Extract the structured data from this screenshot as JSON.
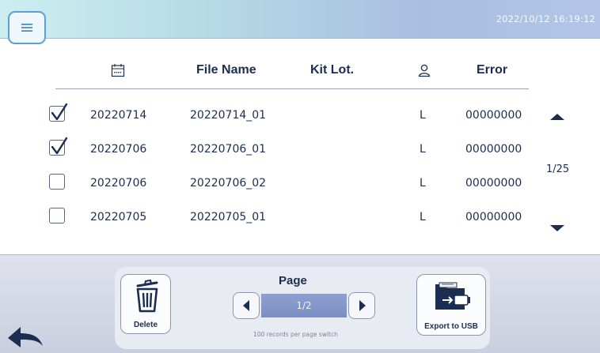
{
  "header": {
    "datetime": "2022/10/12  16:19:12",
    "menu_icon": "hamburger-icon"
  },
  "table": {
    "columns": [
      {
        "icon": "calendar-icon",
        "label": ""
      },
      {
        "label": "File Name"
      },
      {
        "label": "Kit Lot."
      },
      {
        "icon": "user-icon",
        "label": ""
      },
      {
        "label": "Error"
      }
    ],
    "rows": [
      {
        "checked": true,
        "date": "20220714",
        "file_name": "20220714_01",
        "kit_lot": "",
        "user": "L",
        "error": "00000000"
      },
      {
        "checked": true,
        "date": "20220706",
        "file_name": "20220706_01",
        "kit_lot": "",
        "user": "L",
        "error": "00000000"
      },
      {
        "checked": false,
        "date": "20220706",
        "file_name": "20220706_02",
        "kit_lot": "",
        "user": "L",
        "error": "00000000"
      },
      {
        "checked": false,
        "date": "20220705",
        "file_name": "20220705_01",
        "kit_lot": "",
        "user": "L",
        "error": "00000000"
      }
    ]
  },
  "pager": {
    "text": "1/25"
  },
  "bottom": {
    "delete_label": "Delete",
    "page_title": "Page",
    "page_value": "1/2",
    "page_hint": "100 records per page switch",
    "export_label": "Export to USB"
  },
  "colors": {
    "accent": "#5d9fd0",
    "pager_fill": "#8094c8",
    "text": "#1b2e52"
  }
}
